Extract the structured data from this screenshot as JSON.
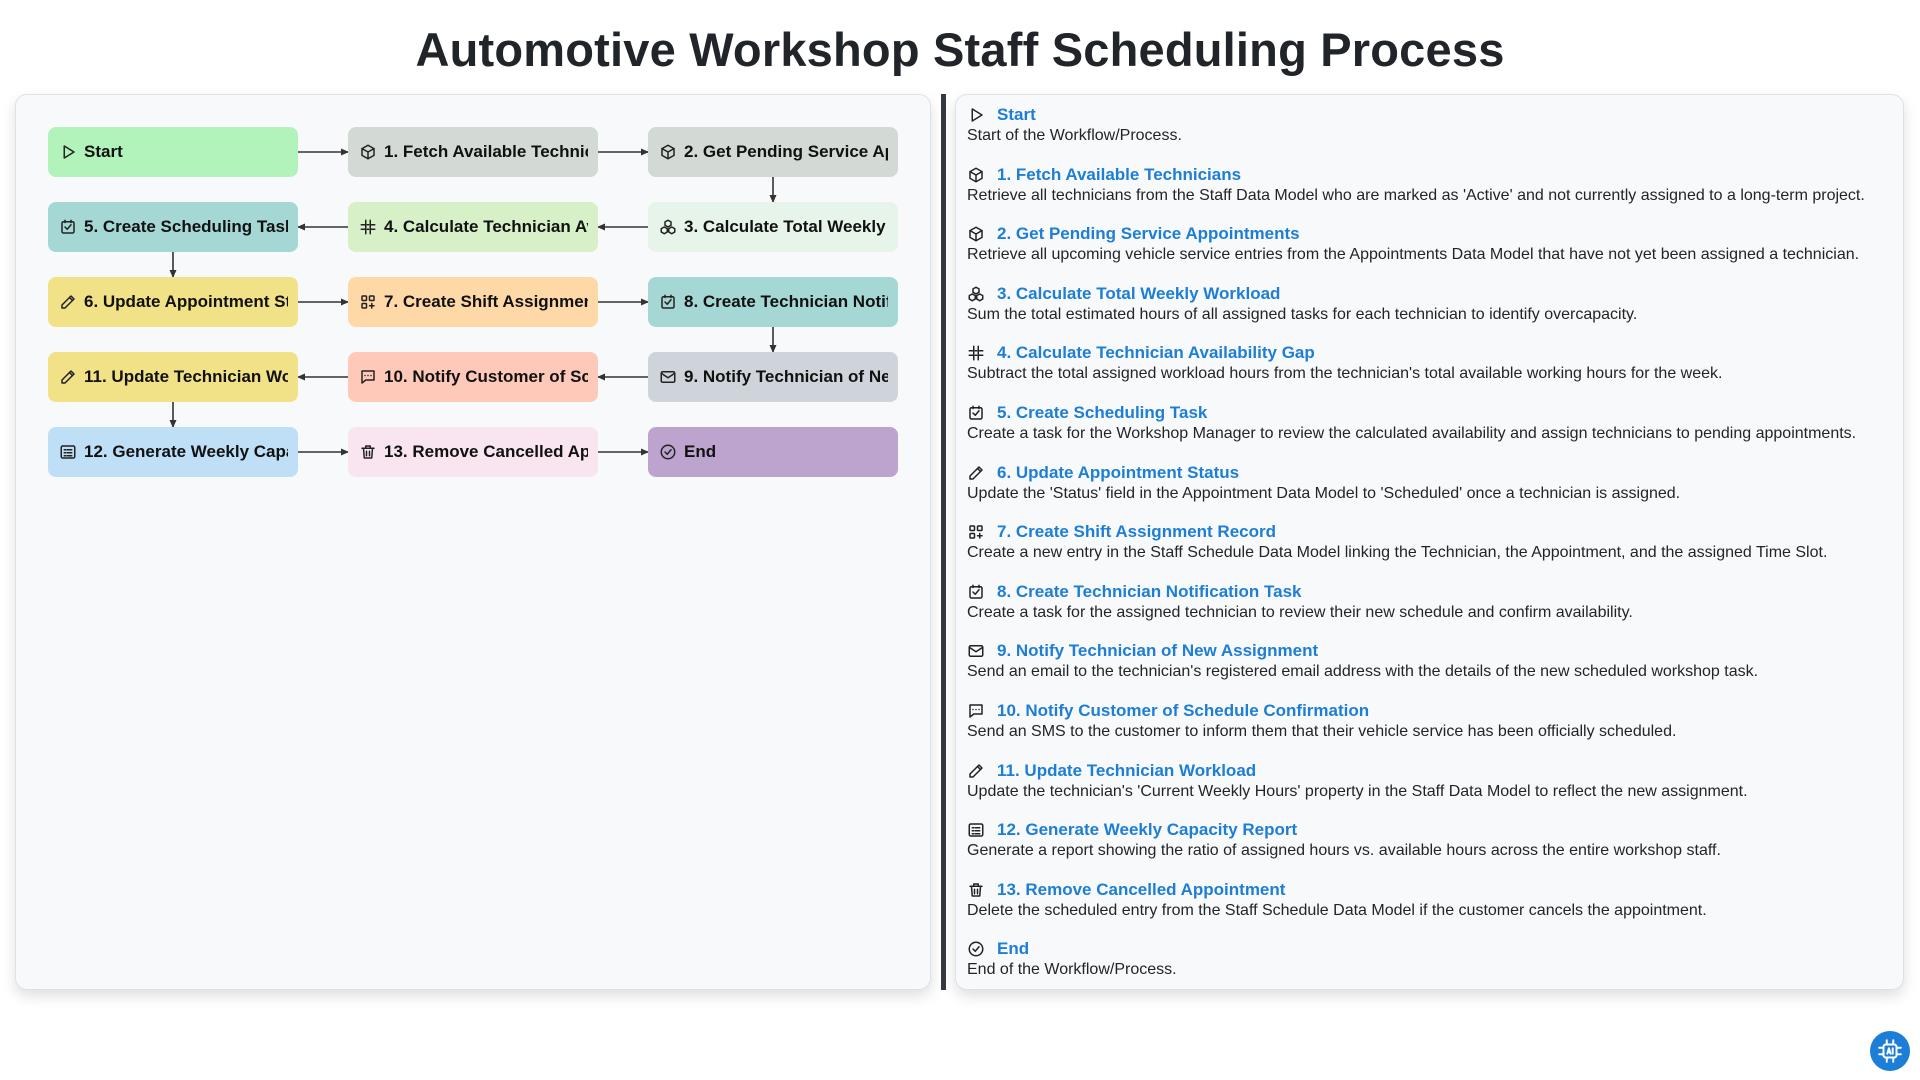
{
  "title": "Automotive Workshop Staff Scheduling Process",
  "nodes": [
    {
      "id": "start",
      "label": "Start",
      "icon": "play-icon",
      "color": "#b2f2bb"
    },
    {
      "id": "n1",
      "label": "1. Fetch Available Technicians",
      "icon": "cube-icon",
      "color": "#d3d9d4"
    },
    {
      "id": "n2",
      "label": "2. Get Pending Service Appointments",
      "icon": "cube-icon",
      "color": "#d3d9d4"
    },
    {
      "id": "n3",
      "label": "3. Calculate Total Weekly Workload",
      "icon": "cubes-stack-icon",
      "color": "#e6f4ea"
    },
    {
      "id": "n4",
      "label": "4. Calculate Technician Availability Gap",
      "icon": "hash-icon",
      "color": "#d8f0c8"
    },
    {
      "id": "n5",
      "label": "5. Create Scheduling Task",
      "icon": "checkbox-icon",
      "color": "#a5d8d5"
    },
    {
      "id": "n6",
      "label": "6. Update Appointment Status",
      "icon": "edit-icon",
      "color": "#f1e187"
    },
    {
      "id": "n7",
      "label": "7. Create Shift Assignment Record",
      "icon": "grid-plus-icon",
      "color": "#ffd8a8"
    },
    {
      "id": "n8",
      "label": "8. Create Technician Notification Task",
      "icon": "checkbox-icon",
      "color": "#a5d8d5"
    },
    {
      "id": "n9",
      "label": "9. Notify Technician of New Assignment",
      "icon": "mail-icon",
      "color": "#ced4da"
    },
    {
      "id": "n10",
      "label": "10. Notify Customer of Schedule Confirmation",
      "icon": "sms-icon",
      "color": "#ffc9b9"
    },
    {
      "id": "n11",
      "label": "11. Update Technician Workload",
      "icon": "edit-icon",
      "color": "#f1e187"
    },
    {
      "id": "n12",
      "label": "12. Generate Weekly Capacity Report",
      "icon": "report-icon",
      "color": "#bfdff7"
    },
    {
      "id": "n13",
      "label": "13. Remove Cancelled Appointment",
      "icon": "trash-icon",
      "color": "#f8e5ef"
    },
    {
      "id": "end",
      "label": "End",
      "icon": "check-circle-icon",
      "color": "#bca4cf"
    }
  ],
  "steps": [
    {
      "title": "Start",
      "icon": "play-icon",
      "desc": "Start of the Workflow/Process."
    },
    {
      "title": "1. Fetch Available Technicians",
      "icon": "cube-icon",
      "desc": "Retrieve all technicians from the Staff Data Model who are marked as 'Active' and not currently assigned to a long-term project."
    },
    {
      "title": "2. Get Pending Service Appointments",
      "icon": "cube-icon",
      "desc": "Retrieve all upcoming vehicle service entries from the Appointments Data Model that have not yet been assigned a technician."
    },
    {
      "title": "3. Calculate Total Weekly Workload",
      "icon": "cubes-stack-icon",
      "desc": "Sum the total estimated hours of all assigned tasks for each technician to identify overcapacity."
    },
    {
      "title": "4. Calculate Technician Availability Gap",
      "icon": "hash-icon",
      "desc": "Subtract the total assigned workload hours from the technician's total available working hours for the week."
    },
    {
      "title": "5. Create Scheduling Task",
      "icon": "checkbox-icon",
      "desc": "Create a task for the Workshop Manager to review the calculated availability and assign technicians to pending appointments."
    },
    {
      "title": "6. Update Appointment Status",
      "icon": "edit-icon",
      "desc": "Update the 'Status' field in the Appointment Data Model to 'Scheduled' once a technician is assigned."
    },
    {
      "title": "7. Create Shift Assignment Record",
      "icon": "grid-plus-icon",
      "desc": "Create a new entry in the Staff Schedule Data Model linking the Technician, the Appointment, and the assigned Time Slot."
    },
    {
      "title": "8. Create Technician Notification Task",
      "icon": "checkbox-icon",
      "desc": "Create a task for the assigned technician to review their new schedule and confirm availability."
    },
    {
      "title": "9. Notify Technician of New Assignment",
      "icon": "mail-icon",
      "desc": "Send an email to the technician's registered email address with the details of the new scheduled workshop task."
    },
    {
      "title": "10. Notify Customer of Schedule Confirmation",
      "icon": "sms-icon",
      "desc": "Send an SMS to the customer to inform them that their vehicle service has been officially scheduled."
    },
    {
      "title": "11. Update Technician Workload",
      "icon": "edit-icon",
      "desc": "Update the technician's 'Current Weekly Hours' property in the Staff Data Model to reflect the new assignment."
    },
    {
      "title": "12. Generate Weekly Capacity Report",
      "icon": "report-icon",
      "desc": "Generate a report showing the ratio of assigned hours vs. available hours across the entire workshop staff."
    },
    {
      "title": "13. Remove Cancelled Appointment",
      "icon": "trash-icon",
      "desc": "Delete the scheduled entry from the Staff Schedule Data Model if the customer cancels the appointment."
    },
    {
      "title": "End",
      "icon": "check-circle-icon",
      "desc": "End of the Workflow/Process."
    }
  ],
  "edges": [
    [
      "start",
      "n1"
    ],
    [
      "n1",
      "n2"
    ],
    [
      "n2",
      "n3"
    ],
    [
      "n3",
      "n4"
    ],
    [
      "n4",
      "n5"
    ],
    [
      "n5",
      "n6"
    ],
    [
      "n6",
      "n7"
    ],
    [
      "n7",
      "n8"
    ],
    [
      "n8",
      "n9"
    ],
    [
      "n9",
      "n10"
    ],
    [
      "n10",
      "n11"
    ],
    [
      "n11",
      "n12"
    ],
    [
      "n12",
      "n13"
    ],
    [
      "n13",
      "end"
    ]
  ],
  "colors": {
    "accent": "#1c7ed6",
    "divider": "#343a40",
    "edge": "#333333"
  },
  "fab_icon": "ai-chip-icon"
}
